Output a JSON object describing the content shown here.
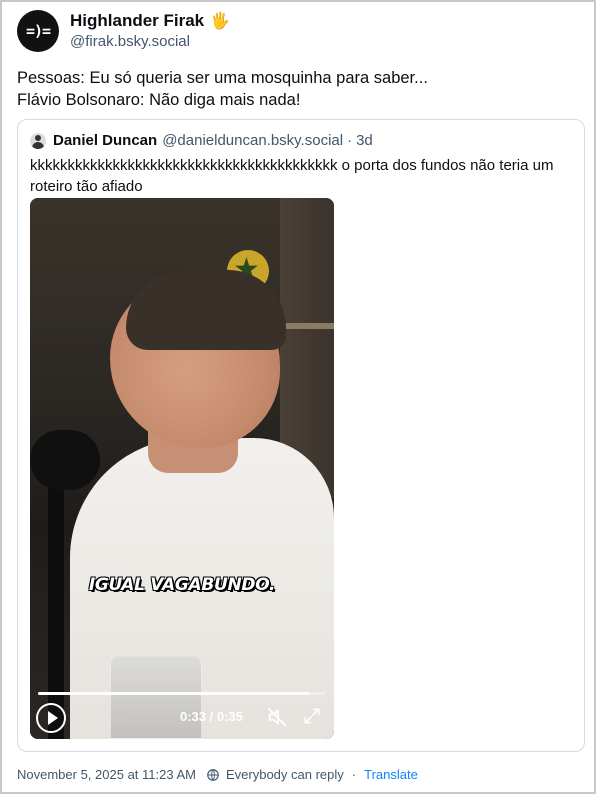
{
  "post": {
    "author": {
      "display_name": "Highlander Firak",
      "badge_emoji": "🖐",
      "handle": "@firak.bsky.social",
      "avatar_text": "=)="
    },
    "text_lines": [
      "Pessoas: Eu só queria ser uma mosquinha para saber...",
      "Flávio Bolsonaro: Não diga mais nada!"
    ],
    "timestamp": "November 5, 2025 at 11:23 AM",
    "reply_setting": "Everybody can reply",
    "separator": "·",
    "translate_label": "Translate"
  },
  "quote": {
    "author_name": "Daniel Duncan",
    "author_handle": "@danielduncan.bsky.social",
    "separator": "·",
    "age": "3d",
    "text": "kkkkkkkkkkkkkkkkkkkkkkkkkkkkkkkkkkkkkkkkk o porta dos fundos não teria um roteiro tão afiado",
    "video": {
      "caption": "IGUAL VAGABUNDO.",
      "time_display": "0:33 / 0:35",
      "progress": 0.94,
      "muted": true
    }
  },
  "colors": {
    "text_primary": "#0b0f14",
    "text_secondary": "#42576c",
    "link": "#1083fe",
    "border": "#d4dbe2"
  }
}
